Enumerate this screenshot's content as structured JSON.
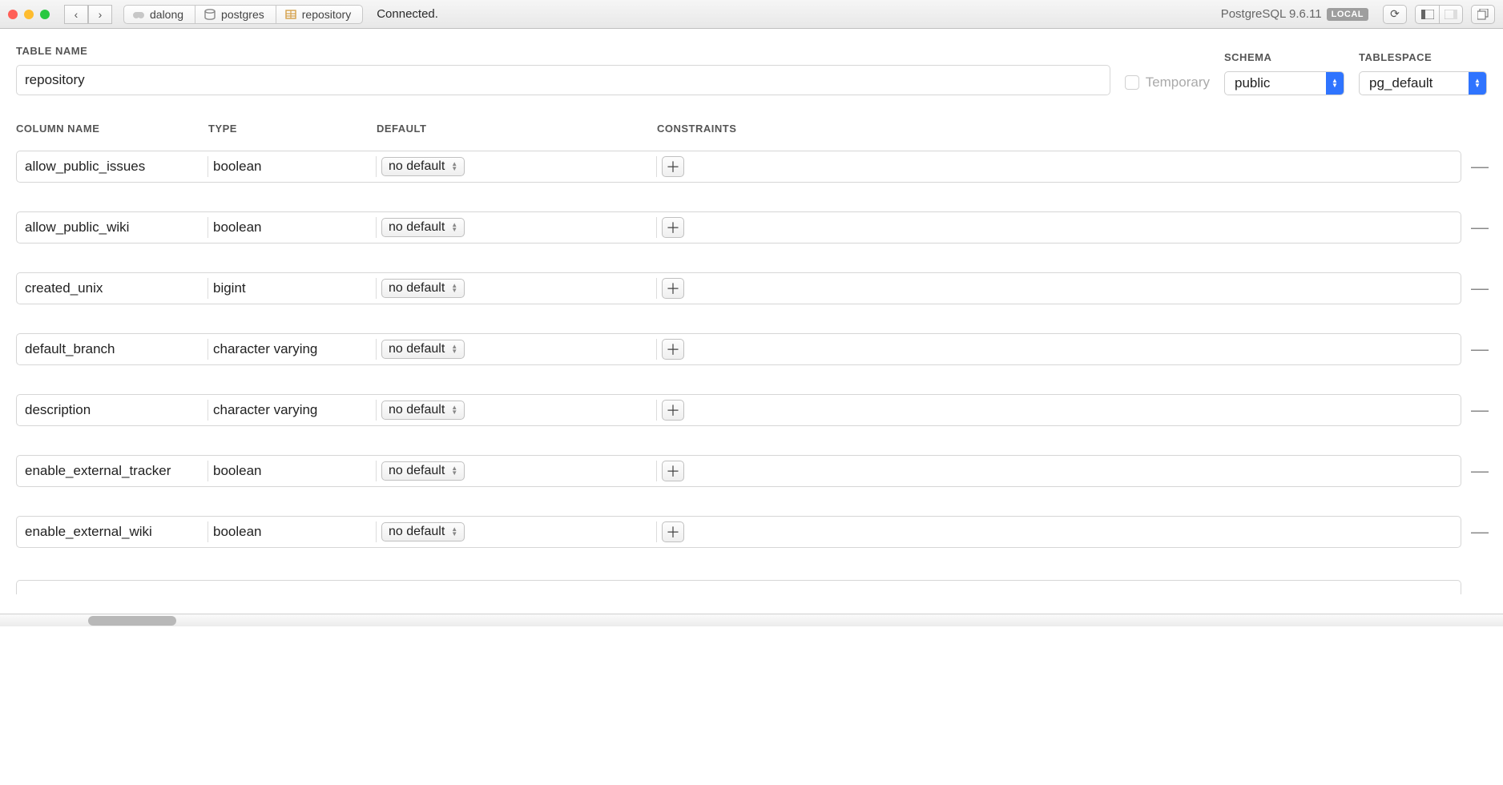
{
  "toolbar": {
    "breadcrumb": [
      {
        "label": "dalong",
        "icon": "elephant"
      },
      {
        "label": "postgres",
        "icon": "database"
      },
      {
        "label": "repository",
        "icon": "table"
      }
    ],
    "status": "Connected.",
    "db_version": "PostgreSQL 9.6.11",
    "local_badge": "LOCAL"
  },
  "labels": {
    "table_name": "TABLE NAME",
    "schema": "SCHEMA",
    "tablespace": "TABLESPACE",
    "temporary": "Temporary",
    "column_name": "COLUMN NAME",
    "type": "TYPE",
    "default": "DEFAULT",
    "constraints": "CONSTRAINTS"
  },
  "form": {
    "table_name_value": "repository",
    "schema_value": "public",
    "tablespace_value": "pg_default"
  },
  "default_label": "no default",
  "columns": [
    {
      "name": "allow_public_issues",
      "type": "boolean"
    },
    {
      "name": "allow_public_wiki",
      "type": "boolean"
    },
    {
      "name": "created_unix",
      "type": "bigint"
    },
    {
      "name": "default_branch",
      "type": "character varying"
    },
    {
      "name": "description",
      "type": "character varying"
    },
    {
      "name": "enable_external_tracker",
      "type": "boolean"
    },
    {
      "name": "enable_external_wiki",
      "type": "boolean"
    }
  ]
}
